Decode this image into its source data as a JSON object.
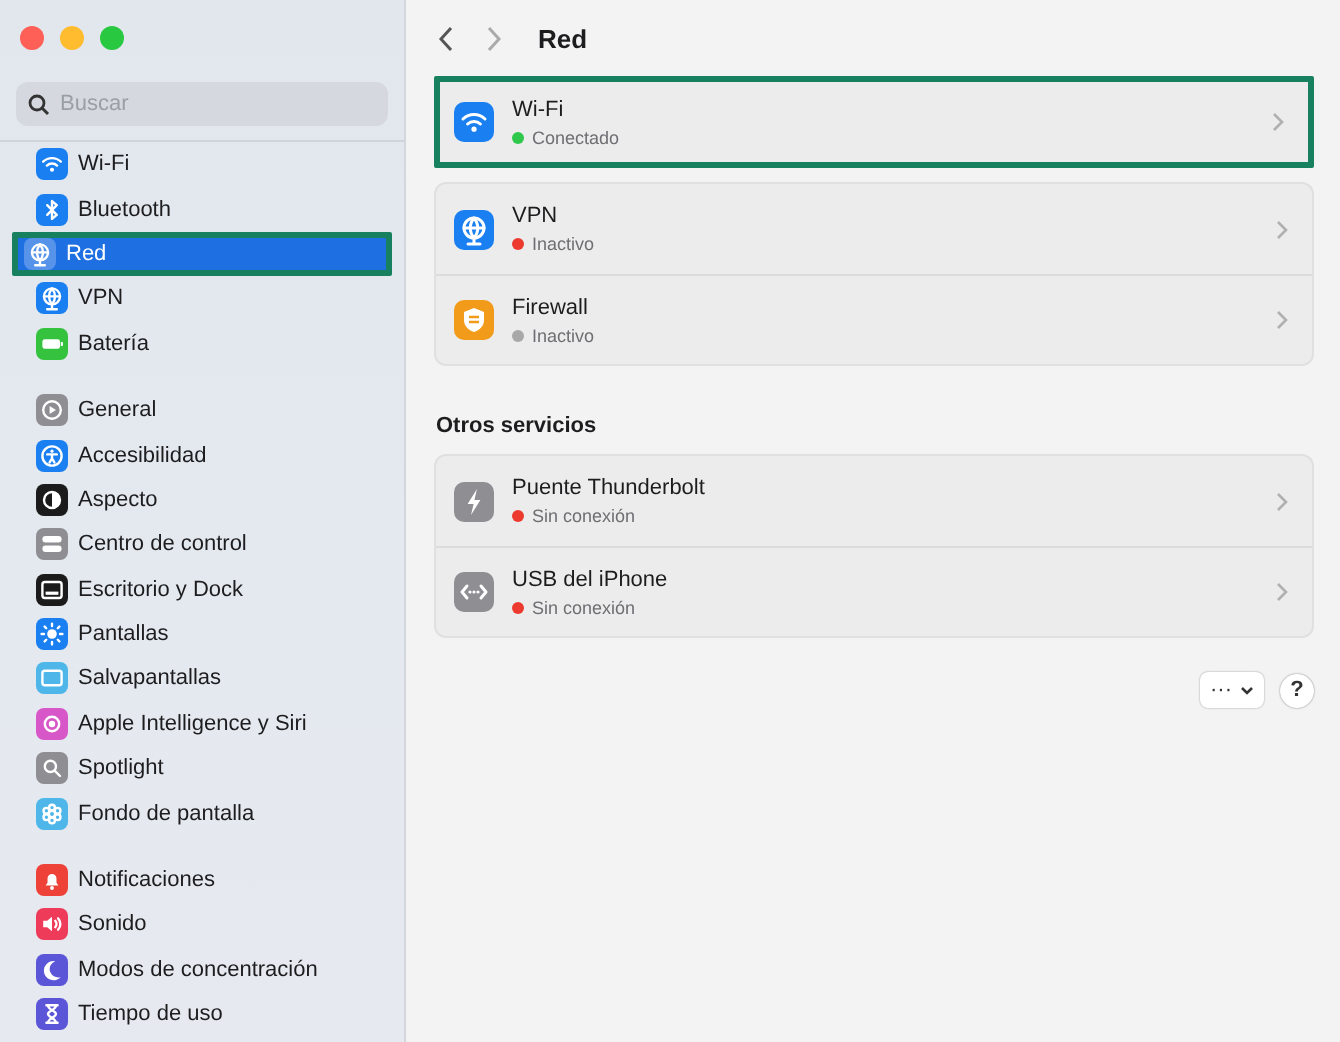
{
  "sidebar": {
    "search": {
      "placeholder": "Buscar"
    },
    "groups": [
      {
        "items": [
          {
            "label": "Wi-Fi",
            "selected": false,
            "highlighted": false
          },
          {
            "label": "Bluetooth",
            "selected": false,
            "highlighted": false
          },
          {
            "label": "Red",
            "selected": true,
            "highlighted": true
          },
          {
            "label": "VPN",
            "selected": false,
            "highlighted": false
          },
          {
            "label": "Batería",
            "selected": false,
            "highlighted": false
          }
        ]
      },
      {
        "items": [
          {
            "label": "General",
            "selected": false,
            "highlighted": false
          },
          {
            "label": "Accesibilidad",
            "selected": false,
            "highlighted": false
          },
          {
            "label": "Aspecto",
            "selected": false,
            "highlighted": false
          },
          {
            "label": "Centro de control",
            "selected": false,
            "highlighted": false
          },
          {
            "label": "Escritorio y Dock",
            "selected": false,
            "highlighted": false
          },
          {
            "label": "Pantallas",
            "selected": false,
            "highlighted": false
          },
          {
            "label": "Salvapantallas",
            "selected": false,
            "highlighted": false
          },
          {
            "label": "Apple Intelligence y Siri",
            "selected": false,
            "highlighted": false
          },
          {
            "label": "Spotlight",
            "selected": false,
            "highlighted": false
          },
          {
            "label": "Fondo de pantalla",
            "selected": false,
            "highlighted": false
          }
        ]
      },
      {
        "items": [
          {
            "label": "Notificaciones",
            "selected": false,
            "highlighted": false
          },
          {
            "label": "Sonido",
            "selected": false,
            "highlighted": false
          },
          {
            "label": "Modos de concentración",
            "selected": false,
            "highlighted": false
          },
          {
            "label": "Tiempo de uso",
            "selected": false,
            "highlighted": false
          }
        ]
      }
    ]
  },
  "header": {
    "title": "Red"
  },
  "sections": [
    {
      "cards": [
        {
          "highlighted": true,
          "rows": [
            {
              "name": "Wi-Fi",
              "status": "Conectado",
              "color": "#2fc84a"
            }
          ]
        },
        {
          "highlighted": false,
          "rows": [
            {
              "name": "VPN",
              "status": "Inactivo",
              "color": "#ec3a2f"
            },
            {
              "name": "Firewall",
              "status": "Inactivo",
              "color": "#a8a8a8"
            }
          ]
        }
      ]
    },
    {
      "heading": "Otros servicios",
      "cards": [
        {
          "highlighted": false,
          "rows": [
            {
              "name": "Puente Thunderbolt",
              "status": "Sin conexión",
              "color": "#ec3a2f"
            },
            {
              "name": "USB del iPhone",
              "status": "Sin conexión",
              "color": "#ec3a2f"
            }
          ]
        }
      ]
    }
  ],
  "footer": {
    "more_button": "···",
    "help_button": "?"
  }
}
